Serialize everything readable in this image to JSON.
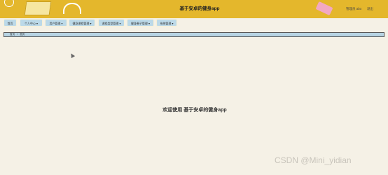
{
  "header": {
    "title": "基于安卓的健身app",
    "user_info": "管理员 abo",
    "logout": "退出"
  },
  "nav": {
    "items": [
      {
        "label": "首页"
      },
      {
        "label": "个人中心 ▾"
      },
      {
        "label": "用户管理 ▾"
      },
      {
        "label": "健身课程管理 ▾"
      },
      {
        "label": "课程类型管理 ▾"
      },
      {
        "label": "健身圈子管理 ▾"
      },
      {
        "label": "系统管理 ▾"
      }
    ]
  },
  "breadcrumb": {
    "home": "首页",
    "separator": "/",
    "current": "首页"
  },
  "main": {
    "welcome": "欢迎使用 基于安卓的健身app"
  },
  "watermark": "CSDN @Mini_yidian",
  "colors": {
    "header_bg": "#e4b72c",
    "nav_button_bg": "#bcd9e8",
    "page_bg": "#f5f1e6"
  }
}
